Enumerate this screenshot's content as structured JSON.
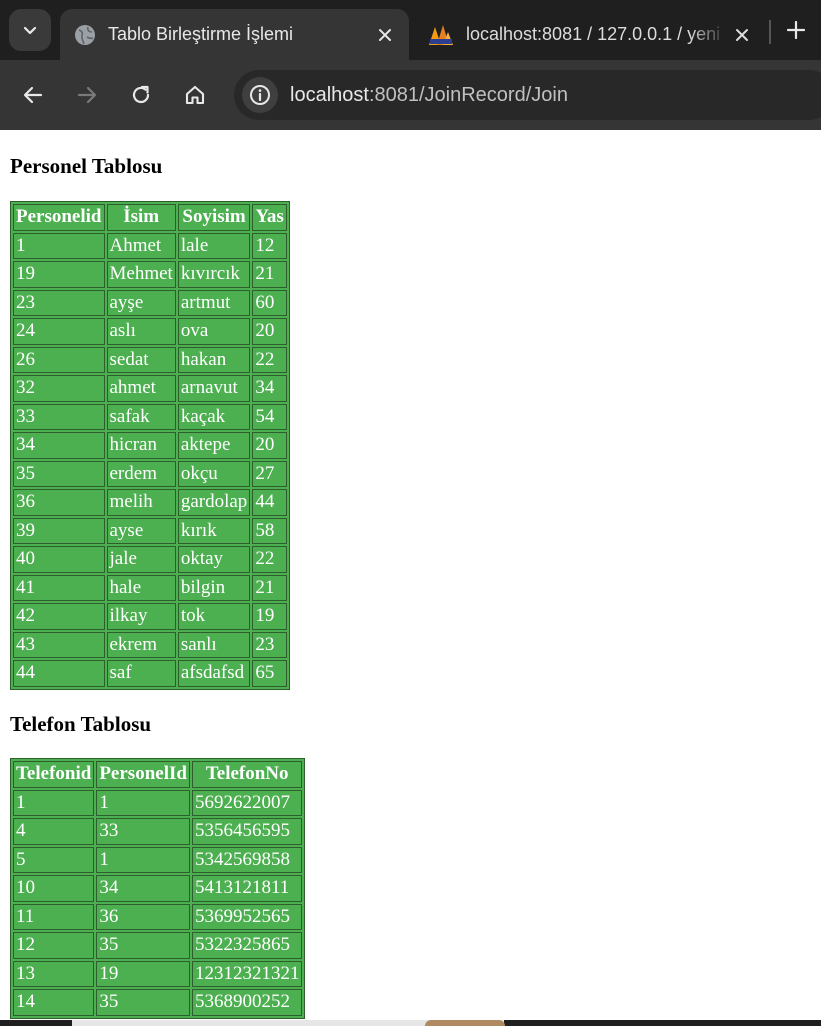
{
  "browser": {
    "tabs": [
      {
        "title": "Tablo Birleştirme İşlemi",
        "active": true
      },
      {
        "title": "localhost:8081 / 127.0.0.1 / yeni",
        "active": false
      }
    ],
    "url_host": "localhost",
    "url_path": ":8081/JoinRecord/Join"
  },
  "personel": {
    "heading": "Personel Tablosu",
    "headers": [
      "Personelid",
      "İsim",
      "Soyisim",
      "Yas"
    ],
    "rows": [
      [
        "1",
        "Ahmet",
        "lale",
        "12"
      ],
      [
        "19",
        "Mehmet",
        "kıvırcık",
        "21"
      ],
      [
        "23",
        "ayşe",
        "artmut",
        "60"
      ],
      [
        "24",
        "aslı",
        "ova",
        "20"
      ],
      [
        "26",
        "sedat",
        "hakan",
        "22"
      ],
      [
        "32",
        "ahmet",
        "arnavut",
        "34"
      ],
      [
        "33",
        "safak",
        "kaçak",
        "54"
      ],
      [
        "34",
        "hicran",
        "aktepe",
        "20"
      ],
      [
        "35",
        "erdem",
        "okçu",
        "27"
      ],
      [
        "36",
        "melih",
        "gardolap",
        "44"
      ],
      [
        "39",
        "ayse",
        "kırık",
        "58"
      ],
      [
        "40",
        "jale",
        "oktay",
        "22"
      ],
      [
        "41",
        "hale",
        "bilgin",
        "21"
      ],
      [
        "42",
        "ilkay",
        "tok",
        "19"
      ],
      [
        "43",
        "ekrem",
        "sanlı",
        "23"
      ],
      [
        "44",
        "saf",
        "afsdafsd",
        "65"
      ]
    ]
  },
  "telefon": {
    "heading": "Telefon Tablosu",
    "headers": [
      "Telefonid",
      "PersonelId",
      "TelefonNo"
    ],
    "rows": [
      [
        "1",
        "1",
        "5692622007"
      ],
      [
        "4",
        "33",
        "5356456595"
      ],
      [
        "5",
        "1",
        "5342569858"
      ],
      [
        "10",
        "34",
        "5413121811"
      ],
      [
        "11",
        "36",
        "5369952565"
      ],
      [
        "12",
        "35",
        "5322325865"
      ],
      [
        "13",
        "19",
        "12312321321"
      ],
      [
        "14",
        "35",
        "5368900252"
      ]
    ]
  },
  "colors": {
    "table_bg": "#4caf50",
    "chrome_dark": "#1f1f1f",
    "chrome_toolbar": "#353535"
  }
}
